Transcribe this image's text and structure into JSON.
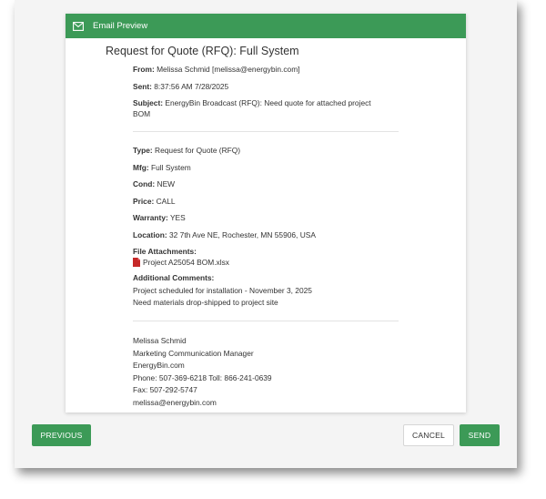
{
  "header": {
    "title": "Email Preview",
    "icon": "envelope-icon"
  },
  "email": {
    "title": "Request for Quote (RFQ): Full System",
    "from_label": "From:",
    "from_value": "Melissa Schmid [melissa@energybin.com]",
    "sent_label": "Sent:",
    "sent_value": "8:37:56 AM 7/28/2025",
    "subject_label": "Subject:",
    "subject_line1": "EnergyBin Broadcast (RFQ): Need quote for attached project",
    "subject_line2": "BOM",
    "type_label": "Type:",
    "type_value": "Request for Quote (RFQ)",
    "mfg_label": "Mfg:",
    "mfg_value": "Full System",
    "cond_label": "Cond:",
    "cond_value": "NEW",
    "price_label": "Price:",
    "price_value": "CALL",
    "warranty_label": "Warranty:",
    "warranty_value": "YES",
    "location_label": "Location:",
    "location_value": "32 7th Ave NE, Rochester, MN 55906, USA",
    "attachments_label": "File Attachments:",
    "attachment_name": "Project A25054 BOM.xlsx",
    "comments_label": "Additional Comments:",
    "comment_line1": "Project scheduled for installation - November 3, 2025",
    "comment_line2": "Need materials drop-shipped to project site",
    "signature": [
      "Melissa Schmid",
      "Marketing Communication Manager",
      "EnergyBin.com",
      "Phone: 507-369-6218 Toll: 866-241-0639",
      "Fax: 507-292-5747",
      "melissa@energybin.com"
    ]
  },
  "buttons": {
    "previous": "PREVIOUS",
    "cancel": "CANCEL",
    "send": "SEND"
  },
  "colors": {
    "accent": "#3c9a57",
    "file_icon": "#c62828"
  }
}
